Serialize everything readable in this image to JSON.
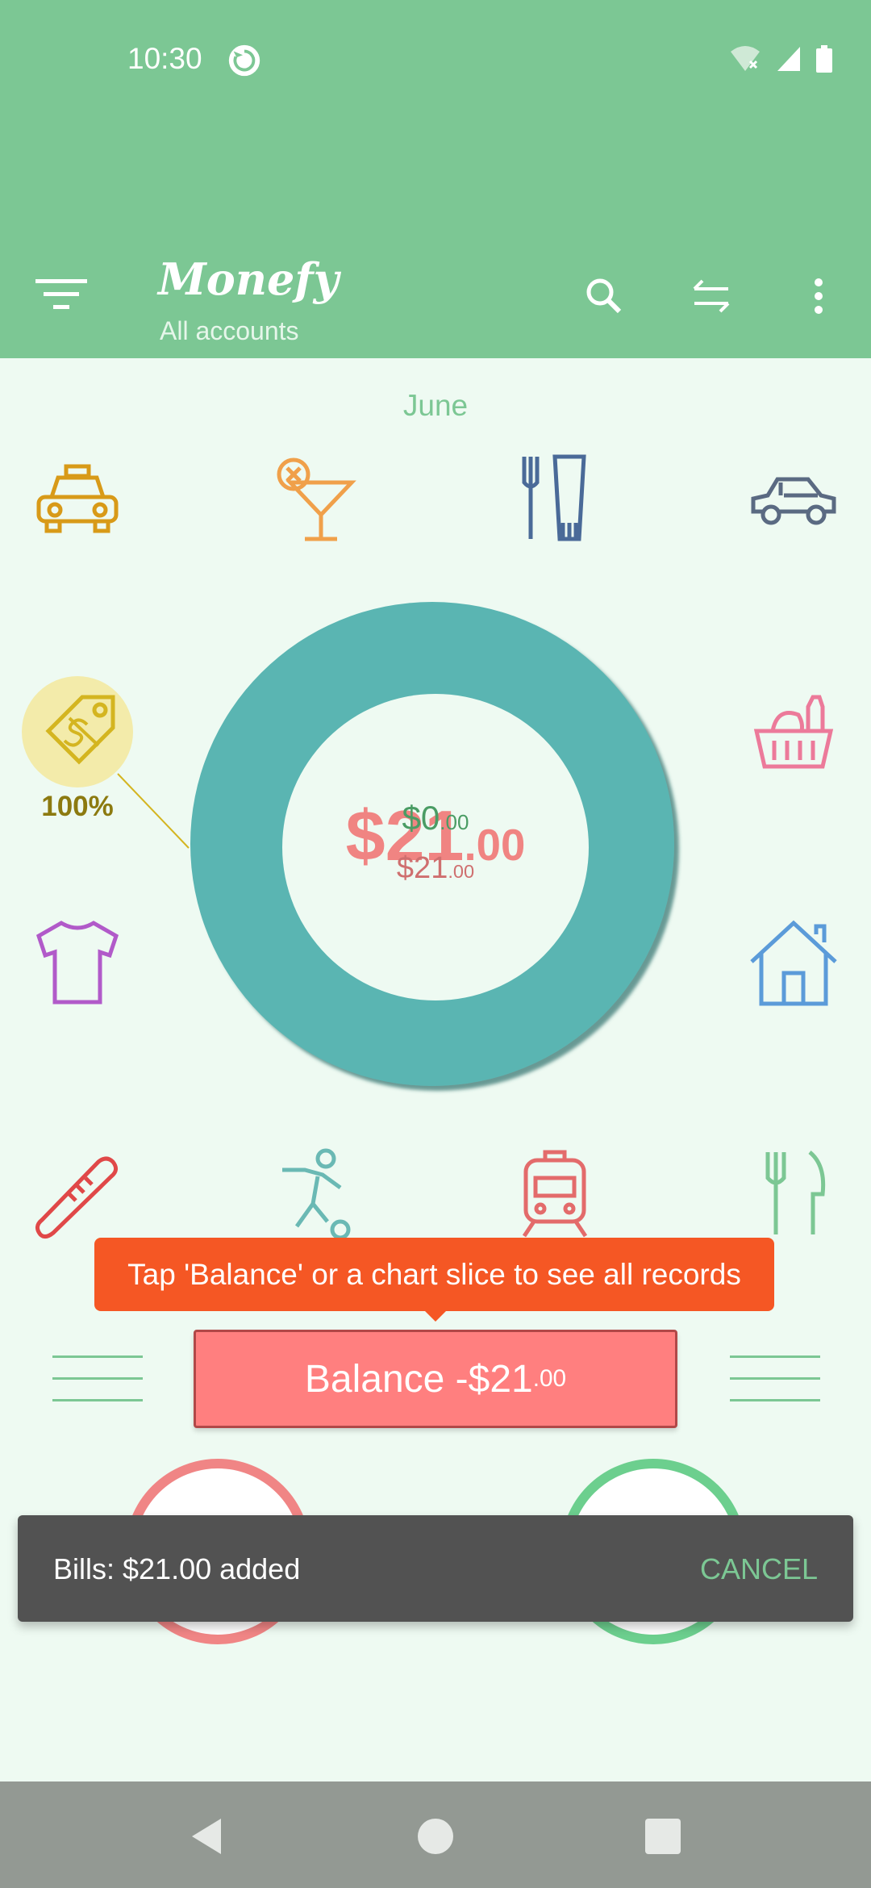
{
  "status_bar": {
    "time": "10:30"
  },
  "app_bar": {
    "title": "Monefy",
    "subtitle": "All accounts"
  },
  "month": "June",
  "categories": {
    "bills_percent": "100%"
  },
  "chart_data": {
    "type": "pie",
    "values": [
      21
    ],
    "labels": [
      "Bills"
    ],
    "colors": [
      "#5ab5b2"
    ]
  },
  "center": {
    "income_main": "$0",
    "income_cents": ".00",
    "expense_main": "$21",
    "expense_cents": ".00",
    "expense_big_main": "$21",
    "expense_big_cents": ".00"
  },
  "tooltip": "Tap 'Balance' or a chart slice to see all records",
  "balance": {
    "label": "Balance -$21",
    "cents": ".00"
  },
  "snackbar": {
    "message": "Bills: $21.00 added",
    "action": "CANCEL"
  },
  "colors": {
    "primary": "#7cc794",
    "expense": "#ff7f7f",
    "tooltip": "#f55724",
    "chart": "#5ab5b2"
  }
}
